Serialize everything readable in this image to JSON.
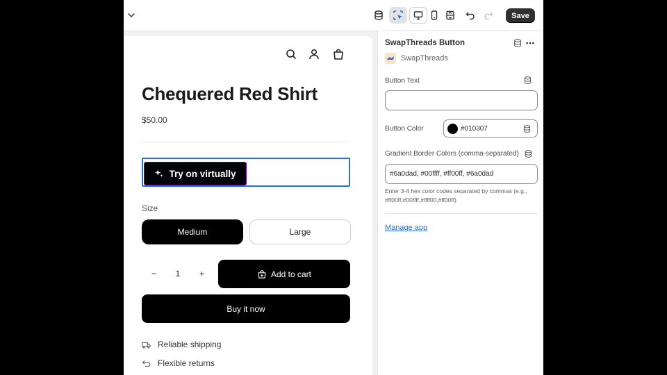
{
  "topbar": {
    "save_label": "Save",
    "icons": [
      "chevron-down-icon",
      "database-icon",
      "inspector-icon",
      "desktop-icon",
      "mobile-icon",
      "fullwidth-icon",
      "undo-icon",
      "redo-icon"
    ]
  },
  "product": {
    "title": "Chequered Red Shirt",
    "price": "$50.00",
    "tryon_label": "Try on virtually",
    "size_label": "Size",
    "sizes": [
      {
        "label": "Medium",
        "selected": true
      },
      {
        "label": "Large",
        "selected": false
      }
    ],
    "quantity_minus": "−",
    "quantity": "1",
    "quantity_plus": "+",
    "add_to_cart": "Add to cart",
    "buy_now": "Buy it now",
    "features": [
      {
        "label": "Reliable shipping",
        "icon": "truck-icon"
      },
      {
        "label": "Flexible returns",
        "icon": "return-icon"
      }
    ]
  },
  "panel": {
    "title": "SwapThreads Button",
    "app_name": "SwapThreads",
    "button_text_label": "Button Text",
    "button_text_value": "",
    "button_color_label": "Button Color",
    "button_color_value": "#010307",
    "gradient_label": "Gradient Border Colors (comma-separated)",
    "gradient_value": "#6a0dad, #00ffff, #ff00ff, #6a0dad",
    "gradient_help": "Enter 3-4 hex color codes separated by commas (e.g., #ff00ff,#00ffff,#ffff00,#ff00ff)",
    "manage_link": "Manage app"
  },
  "colors": {
    "accent_blue": "#2c6ecb",
    "button_color": "#010307",
    "save_bg": "#303030"
  }
}
